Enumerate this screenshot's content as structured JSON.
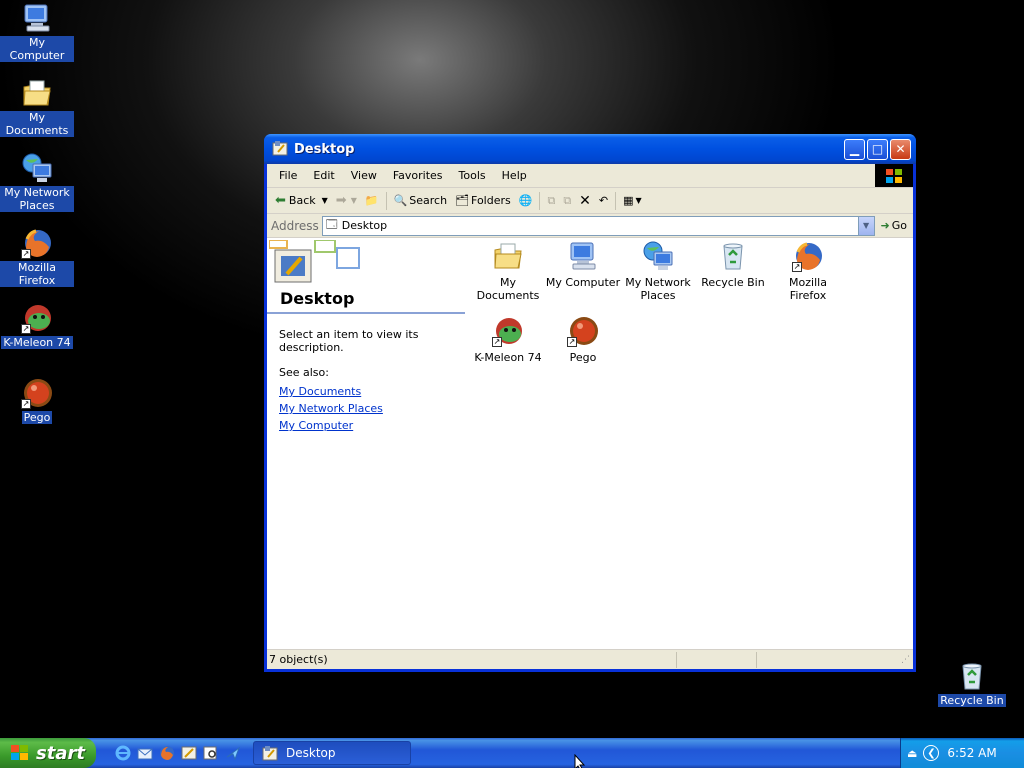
{
  "desktop": {
    "icons": [
      {
        "label": "My Computer",
        "icon": "my-computer-icon"
      },
      {
        "label": "My Documents",
        "icon": "my-documents-icon"
      },
      {
        "label": "My Network Places",
        "icon": "network-places-icon"
      },
      {
        "label": "Mozilla Firefox",
        "icon": "firefox-icon"
      },
      {
        "label": "K-Meleon 74",
        "icon": "kmeleon-icon"
      },
      {
        "label": "Pego",
        "icon": "pego-icon"
      },
      {
        "label": "Recycle Bin",
        "icon": "recycle-bin-icon"
      }
    ]
  },
  "window": {
    "title": "Desktop",
    "menu": [
      "File",
      "Edit",
      "View",
      "Favorites",
      "Tools",
      "Help"
    ],
    "toolbar": {
      "back": "Back",
      "search": "Search",
      "folders": "Folders"
    },
    "address": {
      "label": "Address",
      "value": "Desktop",
      "go": "Go"
    },
    "taskpane": {
      "title": "Desktop",
      "description": "Select an item to view its description.",
      "see_also": "See also:",
      "links": [
        "My Documents",
        "My Network Places",
        "My Computer"
      ]
    },
    "items": [
      {
        "label": "My Documents"
      },
      {
        "label": "My Computer"
      },
      {
        "label": "My Network Places"
      },
      {
        "label": "Recycle Bin"
      },
      {
        "label": "Mozilla Firefox"
      },
      {
        "label": "K-Meleon 74"
      },
      {
        "label": "Pego"
      }
    ],
    "status": "7 object(s)"
  },
  "taskbar": {
    "start": "start",
    "task_button": "Desktop",
    "clock": "6:52 AM"
  }
}
